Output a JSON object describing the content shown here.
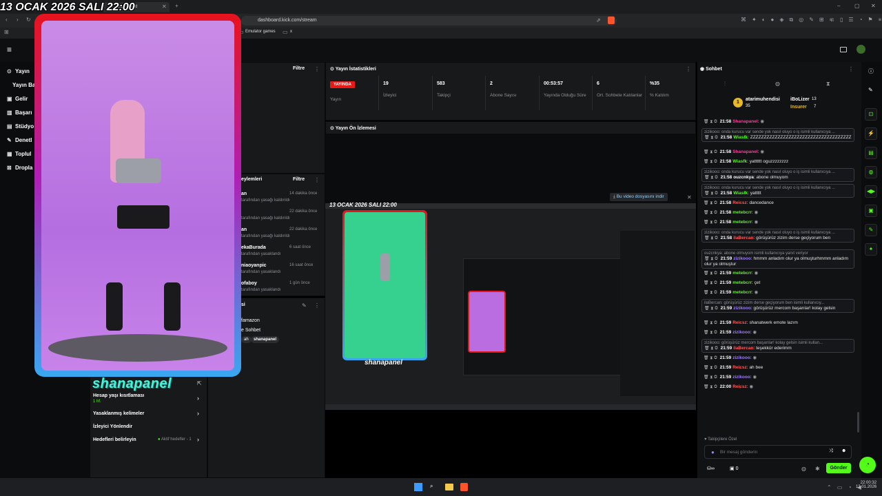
{
  "overlay": {
    "date_title": "13 OCAK 2026 SALI 22:00",
    "channel_name": "shanapanel"
  },
  "browser": {
    "tab_title": "Dashboard",
    "url": "dashboard.kick.com/stream",
    "bookmarks": [
      "Emulator games",
      "x"
    ]
  },
  "nav": {
    "items": [
      "Yayın",
      "Yayın Ba",
      "Gelir",
      "Başarı",
      "Stüdyo",
      "Denetl",
      "Toplul",
      "Dropla"
    ]
  },
  "middle_panel": {
    "filter_top": "Filtre",
    "actions_title": "eylemleri",
    "filter_actions": "Filtre",
    "actions": [
      {
        "user": "an",
        "desc": "tarafından yasağı kaldırıldı",
        "time": "14 dakika önce"
      },
      {
        "user": "",
        "desc": "tarafından yasağı kaldırıldı",
        "time": "22 dakika önce"
      },
      {
        "user": "an",
        "desc": "tarafından yasağı kaldırıldı",
        "time": "22 dakika önce"
      },
      {
        "user": "ekaBurada",
        "desc": "tarafından yasaklandı",
        "time": "6 saat önce"
      },
      {
        "user": "niaoyanpic",
        "desc": "tarafından yasaklandı",
        "time": "16 saat önce"
      },
      {
        "user": "ofaboy",
        "desc": "tarafından yasaklandı",
        "time": "1 gün önce"
      }
    ],
    "chat_settings_title": "si",
    "chat_settings_rows": [
      "famazon",
      "e Sohbet"
    ],
    "chips": [
      "ah",
      "shanapanel"
    ],
    "settings": [
      {
        "label": "Hesap yaşı kısıtlaması",
        "sub": "1 hf."
      },
      {
        "label": "Yasaklanmış kelimeler",
        "sub": ""
      },
      {
        "label": "İzleyici Yönlendir",
        "sub": ""
      },
      {
        "label": "Hedefleri belirleyin",
        "sub": "Aktif hedefler - 1"
      }
    ]
  },
  "stats": {
    "title": "Yayın İstatistikleri",
    "live_badge": "YAYINDA",
    "items": [
      {
        "value": "",
        "label": "Yayın"
      },
      {
        "value": "19",
        "label": "İzleyici"
      },
      {
        "value": "583",
        "label": "Takipçi"
      },
      {
        "value": "2",
        "label": "Abone Sayısı"
      },
      {
        "value": "00:53:57",
        "label": "Yayında Olduğu Süre"
      },
      {
        "value": "6",
        "label": "Ort. Sohbete Katılanlar"
      },
      {
        "value": "%35",
        "label": "% Katılım"
      }
    ]
  },
  "preview": {
    "title": "Yayın Ön İzlemesi",
    "download_hint": "Bu video dosyasını indir"
  },
  "chat": {
    "title": "Sohbet",
    "top_user_1": "atarimuhendisi",
    "top_user_1_count": "35",
    "top_user_2": "iBoLizer",
    "top_user_2_count": "13",
    "top_user_3": "Insurer",
    "top_user_3_count": "7",
    "messages": [
      {
        "time": "21:58",
        "user": "Shanapanel",
        "text": "",
        "color": "#ff3aa0",
        "reply": ""
      },
      {
        "time": "21:58",
        "user": "Wiasfk",
        "text": "ZZZZZZZZZZZZZZZZZZZZZZZZZZZZZZZZZZZZZ",
        "color": "#53fc18",
        "reply": "zizikooo: onda kurucu var sende yok nasıl oluyo o iş isimli kullanıcıya ..."
      },
      {
        "time": "21:58",
        "user": "Shanapanel",
        "text": "",
        "color": "#ff3aa0",
        "reply": ""
      },
      {
        "time": "21:58",
        "user": "Wiasfk",
        "text": "yatttttt oguzzzzzzzz",
        "color": "#53fc18",
        "reply": ""
      },
      {
        "time": "21:58",
        "user": "ouzcnkya",
        "text": "abone olmuyom",
        "color": "#fff",
        "reply": "zizikooo: onda kurucu var sende yok nasıl oluyo o iş isimli kullanıcıya ..."
      },
      {
        "time": "21:58",
        "user": "Wiasfk",
        "text": "yattttt",
        "color": "#53fc18",
        "reply": "zizikooo: onda kurucu var sende yok nasıl oluyo o iş isimli kullanıcıya ..."
      },
      {
        "time": "21:58",
        "user": "Reicsz",
        "text": "dancedance",
        "color": "#ff5a5a",
        "reply": ""
      },
      {
        "time": "21:58",
        "user": "metebcrr",
        "text": "",
        "color": "#53fc18",
        "reply": ""
      },
      {
        "time": "21:58",
        "user": "metebcrr",
        "text": "",
        "color": "#53fc18",
        "reply": ""
      },
      {
        "time": "21:58",
        "user": "ilaBercan",
        "text": "görüşürüz zizim derse geçiyorum ben",
        "color": "#ff5a5a",
        "reply": "zizikooo: onda kurucu var sende yok nasıl oluyo o iş isimli kullanıcıya ..."
      },
      {
        "time": "21:59",
        "user": "zizikooo",
        "text": "hmmm anladım olur ya olmuşturhmmm anladım olur ya olmuştur",
        "color": "#9d7bff",
        "reply": "ouzcnkya: abone olmuyom isimli kullanıcıya yanıt veriyor"
      },
      {
        "time": "21:59",
        "user": "metebcrr",
        "text": "",
        "color": "#53fc18",
        "reply": ""
      },
      {
        "time": "21:59",
        "user": "metebcrr",
        "text": "çet",
        "color": "#53fc18",
        "reply": ""
      },
      {
        "time": "21:59",
        "user": "metebcrr",
        "text": "",
        "color": "#53fc18",
        "reply": ""
      },
      {
        "time": "21:59",
        "user": "zizikooo",
        "text": "görüşürüz mercom başarılar! kolay gelsin",
        "color": "#9d7bff",
        "reply": "ilaBercan: görüşürüz zizim derse geçiyorum ben isimli kullanıcıy..."
      },
      {
        "time": "21:59",
        "user": "Reicsz",
        "text": "shanatwerk emote lazım",
        "color": "#ff5a5a",
        "reply": ""
      },
      {
        "time": "21:59",
        "user": "zizikooo",
        "text": "",
        "color": "#9d7bff",
        "reply": ""
      },
      {
        "time": "21:59",
        "user": "ilaBercan",
        "text": "teşekkür ederimm",
        "color": "#ff5a5a",
        "reply": "zizikooo: görüşürüz mercom başarılar! kolay gelsin isimli kullan..."
      },
      {
        "time": "21:59",
        "user": "zizikooo",
        "text": "",
        "color": "#9d7bff",
        "reply": ""
      },
      {
        "time": "21:59",
        "user": "Reicsz",
        "text": "ah bee",
        "color": "#ff5a5a",
        "reply": ""
      },
      {
        "time": "21:59",
        "user": "zizikooo",
        "text": "",
        "color": "#9d7bff",
        "reply": ""
      },
      {
        "time": "22:00",
        "user": "Reicsz",
        "text": "",
        "color": "#ff5a5a",
        "reply": ""
      }
    ],
    "followers_only": "Takipçilere Özel",
    "input_placeholder": "Bir mesaj gönderin",
    "points": "0",
    "send_label": "Gönder"
  },
  "taskbar": {
    "time": "22:00:32",
    "date": "13.01.2026"
  },
  "colors": {
    "accent": "#53fc18",
    "live": "#e91916"
  }
}
